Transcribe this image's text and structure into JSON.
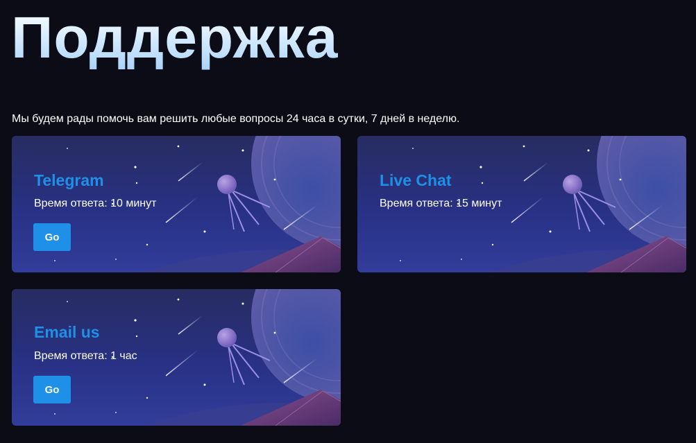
{
  "page": {
    "title": "Поддержка",
    "intro": "Мы будем рады помочь вам решить любые вопросы 24 часа в сутки, 7 дней в неделю."
  },
  "cards": [
    {
      "title": "Telegram",
      "response_time": "Время ответа: 10 минут",
      "button_label": "Go"
    },
    {
      "title": "Live Chat",
      "response_time": "Время ответа: 15 минут",
      "button_label": ""
    },
    {
      "title": "Email us",
      "response_time": "Время ответа: 1 час",
      "button_label": "Go"
    }
  ],
  "colors": {
    "background": "#0b0c15",
    "accent": "#1e90e8",
    "card_dark": "#22296a",
    "text": "#ffffff"
  },
  "icons": {
    "card_illustration": "space-satellite-illustration"
  }
}
